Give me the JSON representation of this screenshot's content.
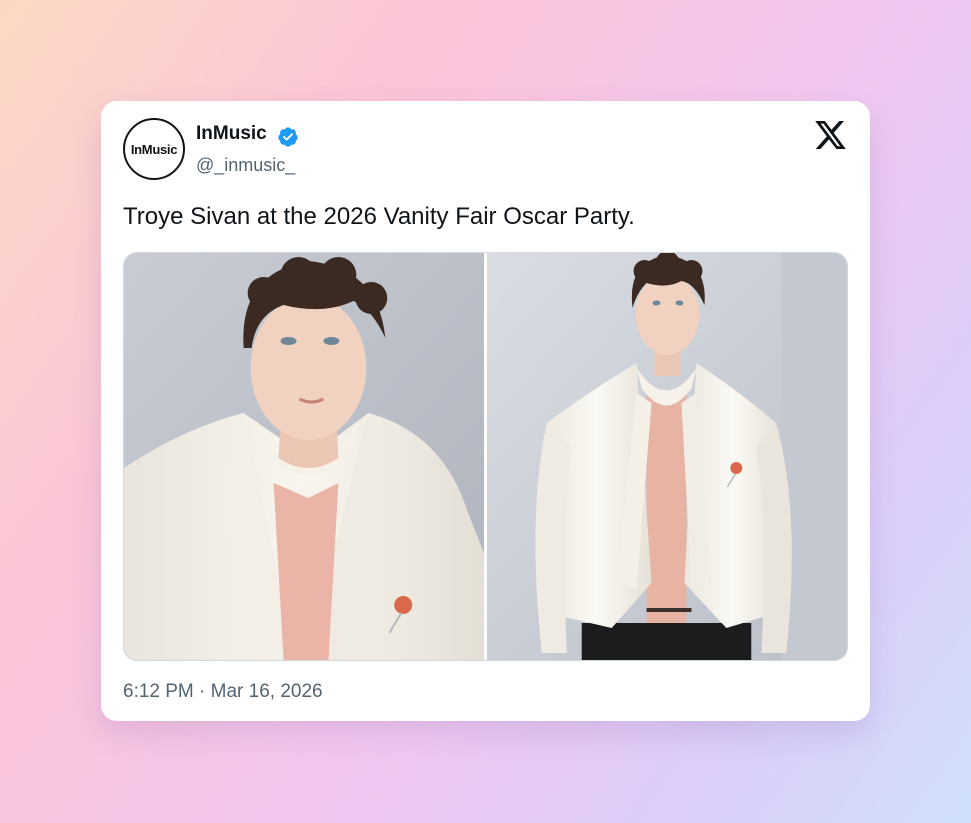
{
  "tweet": {
    "avatar_text": "InMusic",
    "display_name": "InMusic",
    "handle": "@_inmusic_",
    "text": "Troye Sivan at the 2026 Vanity Fair Oscar Party.",
    "timestamp": "6:12 PM · Mar 16, 2026",
    "icons": {
      "verified": "verified-badge-icon",
      "platform": "x-logo-icon"
    },
    "media": [
      {
        "alt": "Close-up photo of a man in a white satin jacket with a pink shirt and rose brooch"
      },
      {
        "alt": "Full-length photo of the man in a cropped white satin jacket and black trousers"
      }
    ]
  },
  "colors": {
    "verified_blue": "#1d9bf0",
    "text_primary": "#0f1419",
    "text_secondary": "#536471"
  }
}
